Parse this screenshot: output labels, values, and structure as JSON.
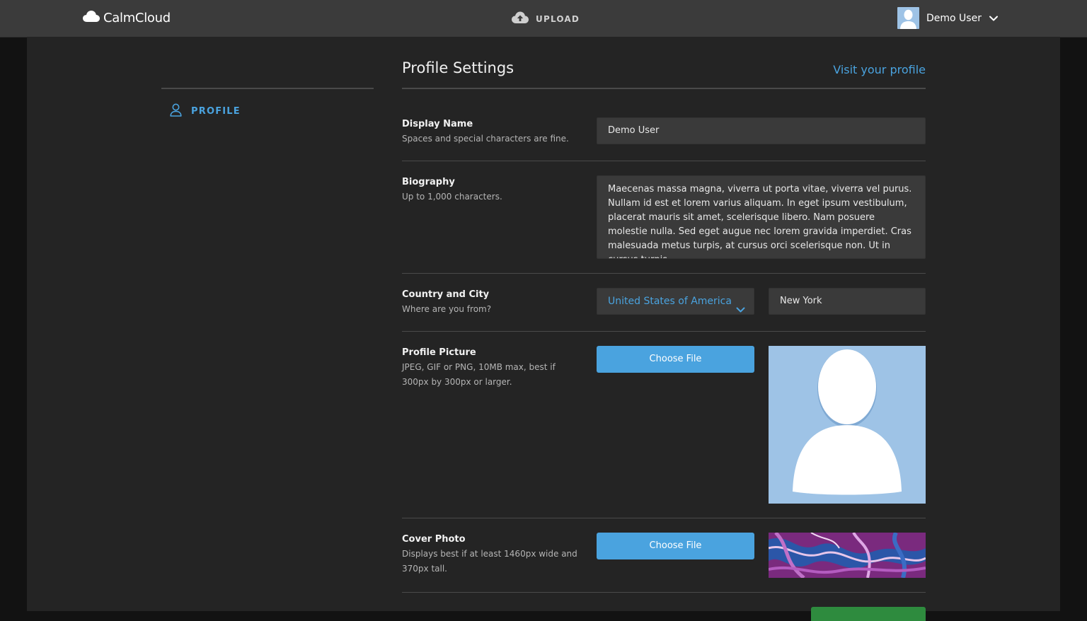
{
  "app": {
    "name": "CalmCloud",
    "upload_label": "UPLOAD",
    "user_name": "Demo User"
  },
  "sidebar": {
    "items": [
      {
        "label": "PROFILE",
        "icon": "user-icon",
        "active": true
      }
    ]
  },
  "settings": {
    "title": "Profile Settings",
    "visit_link": "Visit your profile",
    "display_name": {
      "label": "Display Name",
      "hint": "Spaces and special characters are fine.",
      "value": "Demo User"
    },
    "biography": {
      "label": "Biography",
      "hint": "Up to 1,000 characters.",
      "value": "Maecenas massa magna, viverra ut porta vitae, viverra vel purus. Nullam id est et lorem varius aliquam. In eget ipsum vestibulum, placerat mauris sit amet, scelerisque libero. Nam posuere molestie nulla. Sed eget augue nec lorem gravida imperdiet. Cras malesuada metus turpis, at cursus orci scelerisque non. Ut in cursus turpis."
    },
    "location": {
      "label": "Country and City",
      "hint": "Where are you from?",
      "country": "United States of America",
      "city": "New York"
    },
    "profile_picture": {
      "label": "Profile Picture",
      "hint": "JPEG, GIF or PNG, 10MB max, best if 300px by 300px or larger.",
      "button": "Choose File"
    },
    "cover_photo": {
      "label": "Cover Photo",
      "hint": "Displays best if at least 1460px wide and 370px tall.",
      "button": "Choose File"
    }
  },
  "colors": {
    "accent": "#4aa3df",
    "topbar": "#3b3b3b",
    "panel": "#242424",
    "field": "#3a3a3a",
    "save": "#2e8b3e"
  }
}
